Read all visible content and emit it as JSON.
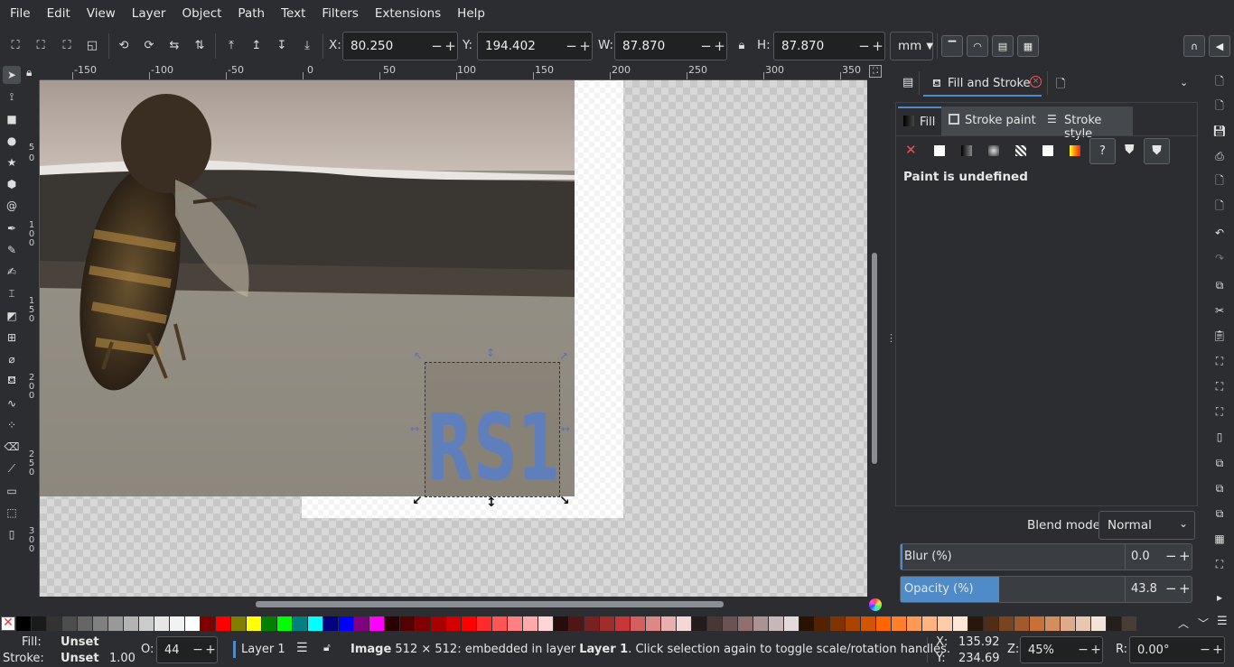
{
  "menubar": {
    "items": [
      "File",
      "Edit",
      "View",
      "Layer",
      "Object",
      "Path",
      "Text",
      "Filters",
      "Extensions",
      "Help"
    ]
  },
  "toolbar": {
    "x_label": "X:",
    "x_value": "80.250",
    "y_label": "Y:",
    "y_value": "194.402",
    "w_label": "W:",
    "w_value": "87.870",
    "h_label": "H:",
    "h_value": "87.870",
    "unit": "mm"
  },
  "ruler": {
    "h_ticks": [
      "-150",
      "-100",
      "-50",
      "0",
      "50",
      "100",
      "150",
      "200",
      "250",
      "300",
      "350"
    ],
    "v_ticks": [
      "5",
      "0",
      "1",
      "0",
      "0",
      "1",
      "5",
      "0",
      "2",
      "0",
      "0",
      "2",
      "5",
      "0",
      "3",
      "0",
      "0"
    ]
  },
  "canvas": {
    "overlay_text": "RS1"
  },
  "dock": {
    "tab_title": "Fill and Stroke",
    "subtabs": [
      "Fill",
      "Stroke paint",
      "Stroke style"
    ],
    "paint_status": "Paint is undefined",
    "blend_label": "Blend mode:",
    "blend_value": "Normal",
    "blur_label": "Blur (%)",
    "blur_value": "0.0",
    "blur_level": 0.0,
    "opacity_label": "Opacity (%)",
    "opacity_value": "43.8",
    "opacity_level": 0.438
  },
  "palette": {
    "colors": [
      "#000000",
      "#1a1a1a",
      "#333333",
      "#4d4d4d",
      "#666666",
      "#808080",
      "#999999",
      "#b3b3b3",
      "#cccccc",
      "#e6e6e6",
      "#f2f2f2",
      "#ffffff",
      "#800000",
      "#ff0000",
      "#808000",
      "#ffff00",
      "#008000",
      "#00ff00",
      "#008080",
      "#00ffff",
      "#000080",
      "#0000ff",
      "#800080",
      "#ff00ff",
      "#2b0000",
      "#550000",
      "#800000",
      "#aa0000",
      "#d40000",
      "#ff0000",
      "#ff2a2a",
      "#ff5555",
      "#ff8080",
      "#ffaaaa",
      "#ffd5d5",
      "#280b0b",
      "#501616",
      "#782121",
      "#a02c2c",
      "#c83737",
      "#d35f5f",
      "#de8787",
      "#e9afaf",
      "#f4d7d7",
      "#241c1c",
      "#483737",
      "#6c5353",
      "#916f6f",
      "#ac9393",
      "#c8b7b7",
      "#e3dbdb",
      "#2b1100",
      "#552200",
      "#803300",
      "#aa4400",
      "#d45500",
      "#ff6600",
      "#ff7f2a",
      "#ff9955",
      "#ffb380",
      "#ffccaa",
      "#ffe6d5",
      "#28170b",
      "#502d16",
      "#784421",
      "#a05a2c",
      "#c87137",
      "#d38d5f",
      "#deaa87",
      "#e9c6af",
      "#f4e3d7",
      "#241f1c",
      "#483e37"
    ]
  },
  "status": {
    "fill_label": "Fill:",
    "fill_value": "Unset",
    "stroke_label": "Stroke:",
    "stroke_value": "Unset",
    "stroke_width": "1.00",
    "opacity_label": "O:",
    "opacity_value": "44",
    "layer_name": "Layer 1",
    "message_bold": "Image",
    "message_mid": " 512 × 512: embedded in layer ",
    "message_layer": "Layer 1",
    "message_tail": ". Click selection again to toggle scale/rotation handles.",
    "x_label": "X:",
    "x_value": "135.92",
    "y_label": "Y:",
    "y_value": "234.69",
    "zoom_label": "Z:",
    "zoom_value": "45%",
    "rotate_label": "R:",
    "rotate_value": "0.00°"
  },
  "colors": {
    "accent": "#4f8bc9",
    "selection_blue": "#5d70b7",
    "panel_bg": "#2b2d30"
  }
}
